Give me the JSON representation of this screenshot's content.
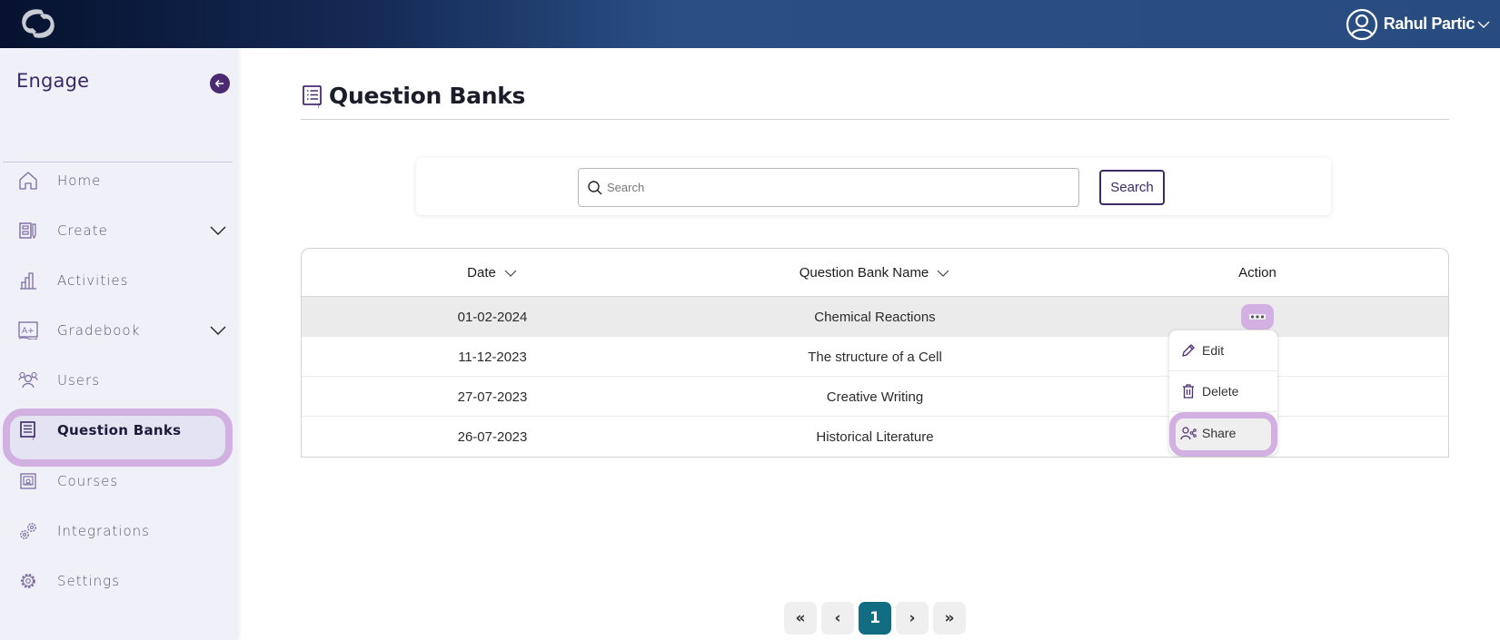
{
  "header": {
    "logo": "app-logo",
    "user_name": "Rahul Partic",
    "user_icon": "user-circle-icon",
    "menu_icon": "chevron-down-icon"
  },
  "sidebar": {
    "brand": "Engage",
    "collapse_icon": "arrow-left-icon",
    "items": [
      {
        "label": "Home",
        "icon": "home-icon",
        "expandable": false
      },
      {
        "label": "Create",
        "icon": "create-icon",
        "expandable": true
      },
      {
        "label": "Activities",
        "icon": "bar-chart-icon",
        "expandable": false
      },
      {
        "label": "Gradebook",
        "icon": "gradebook-icon",
        "expandable": true
      },
      {
        "label": "Users",
        "icon": "users-icon",
        "expandable": false
      },
      {
        "label": "Question Banks",
        "icon": "question-list-icon",
        "expandable": false,
        "active": true
      },
      {
        "label": "Courses",
        "icon": "courses-icon",
        "expandable": false
      },
      {
        "label": "Integrations",
        "icon": "gears-icon",
        "expandable": false
      },
      {
        "label": "Settings",
        "icon": "gear-icon",
        "expandable": false
      }
    ]
  },
  "page": {
    "title": "Question Banks",
    "title_icon": "question-list-icon"
  },
  "search": {
    "placeholder": "Search",
    "value": "",
    "button_label": "Search"
  },
  "table": {
    "columns": [
      {
        "label": "Date",
        "sortable": true
      },
      {
        "label": "Question Bank Name",
        "sortable": true
      },
      {
        "label": "Action",
        "sortable": false
      }
    ],
    "rows": [
      {
        "date": "01-02-2024",
        "name": "Chemical Reactions",
        "selected": true
      },
      {
        "date": "11-12-2023",
        "name": "The structure of a Cell"
      },
      {
        "date": "27-07-2023",
        "name": "Creative Writing"
      },
      {
        "date": "26-07-2023",
        "name": "Historical Literature"
      }
    ],
    "action_icon": "more-horizontal-icon"
  },
  "action_menu": {
    "items": [
      {
        "label": "Edit",
        "icon": "pencil-icon"
      },
      {
        "label": "Delete",
        "icon": "trash-icon"
      },
      {
        "label": "Share",
        "icon": "share-users-icon",
        "highlighted": true
      }
    ]
  },
  "pagination": {
    "first": "«",
    "prev": "‹",
    "current": "1",
    "next": "›",
    "last": "»"
  },
  "colors": {
    "accent_purple": "#4b2a72",
    "highlight": "#d2b0e2",
    "page_active": "#136d82",
    "header_start": "#06122f",
    "header_end": "#294c80"
  }
}
